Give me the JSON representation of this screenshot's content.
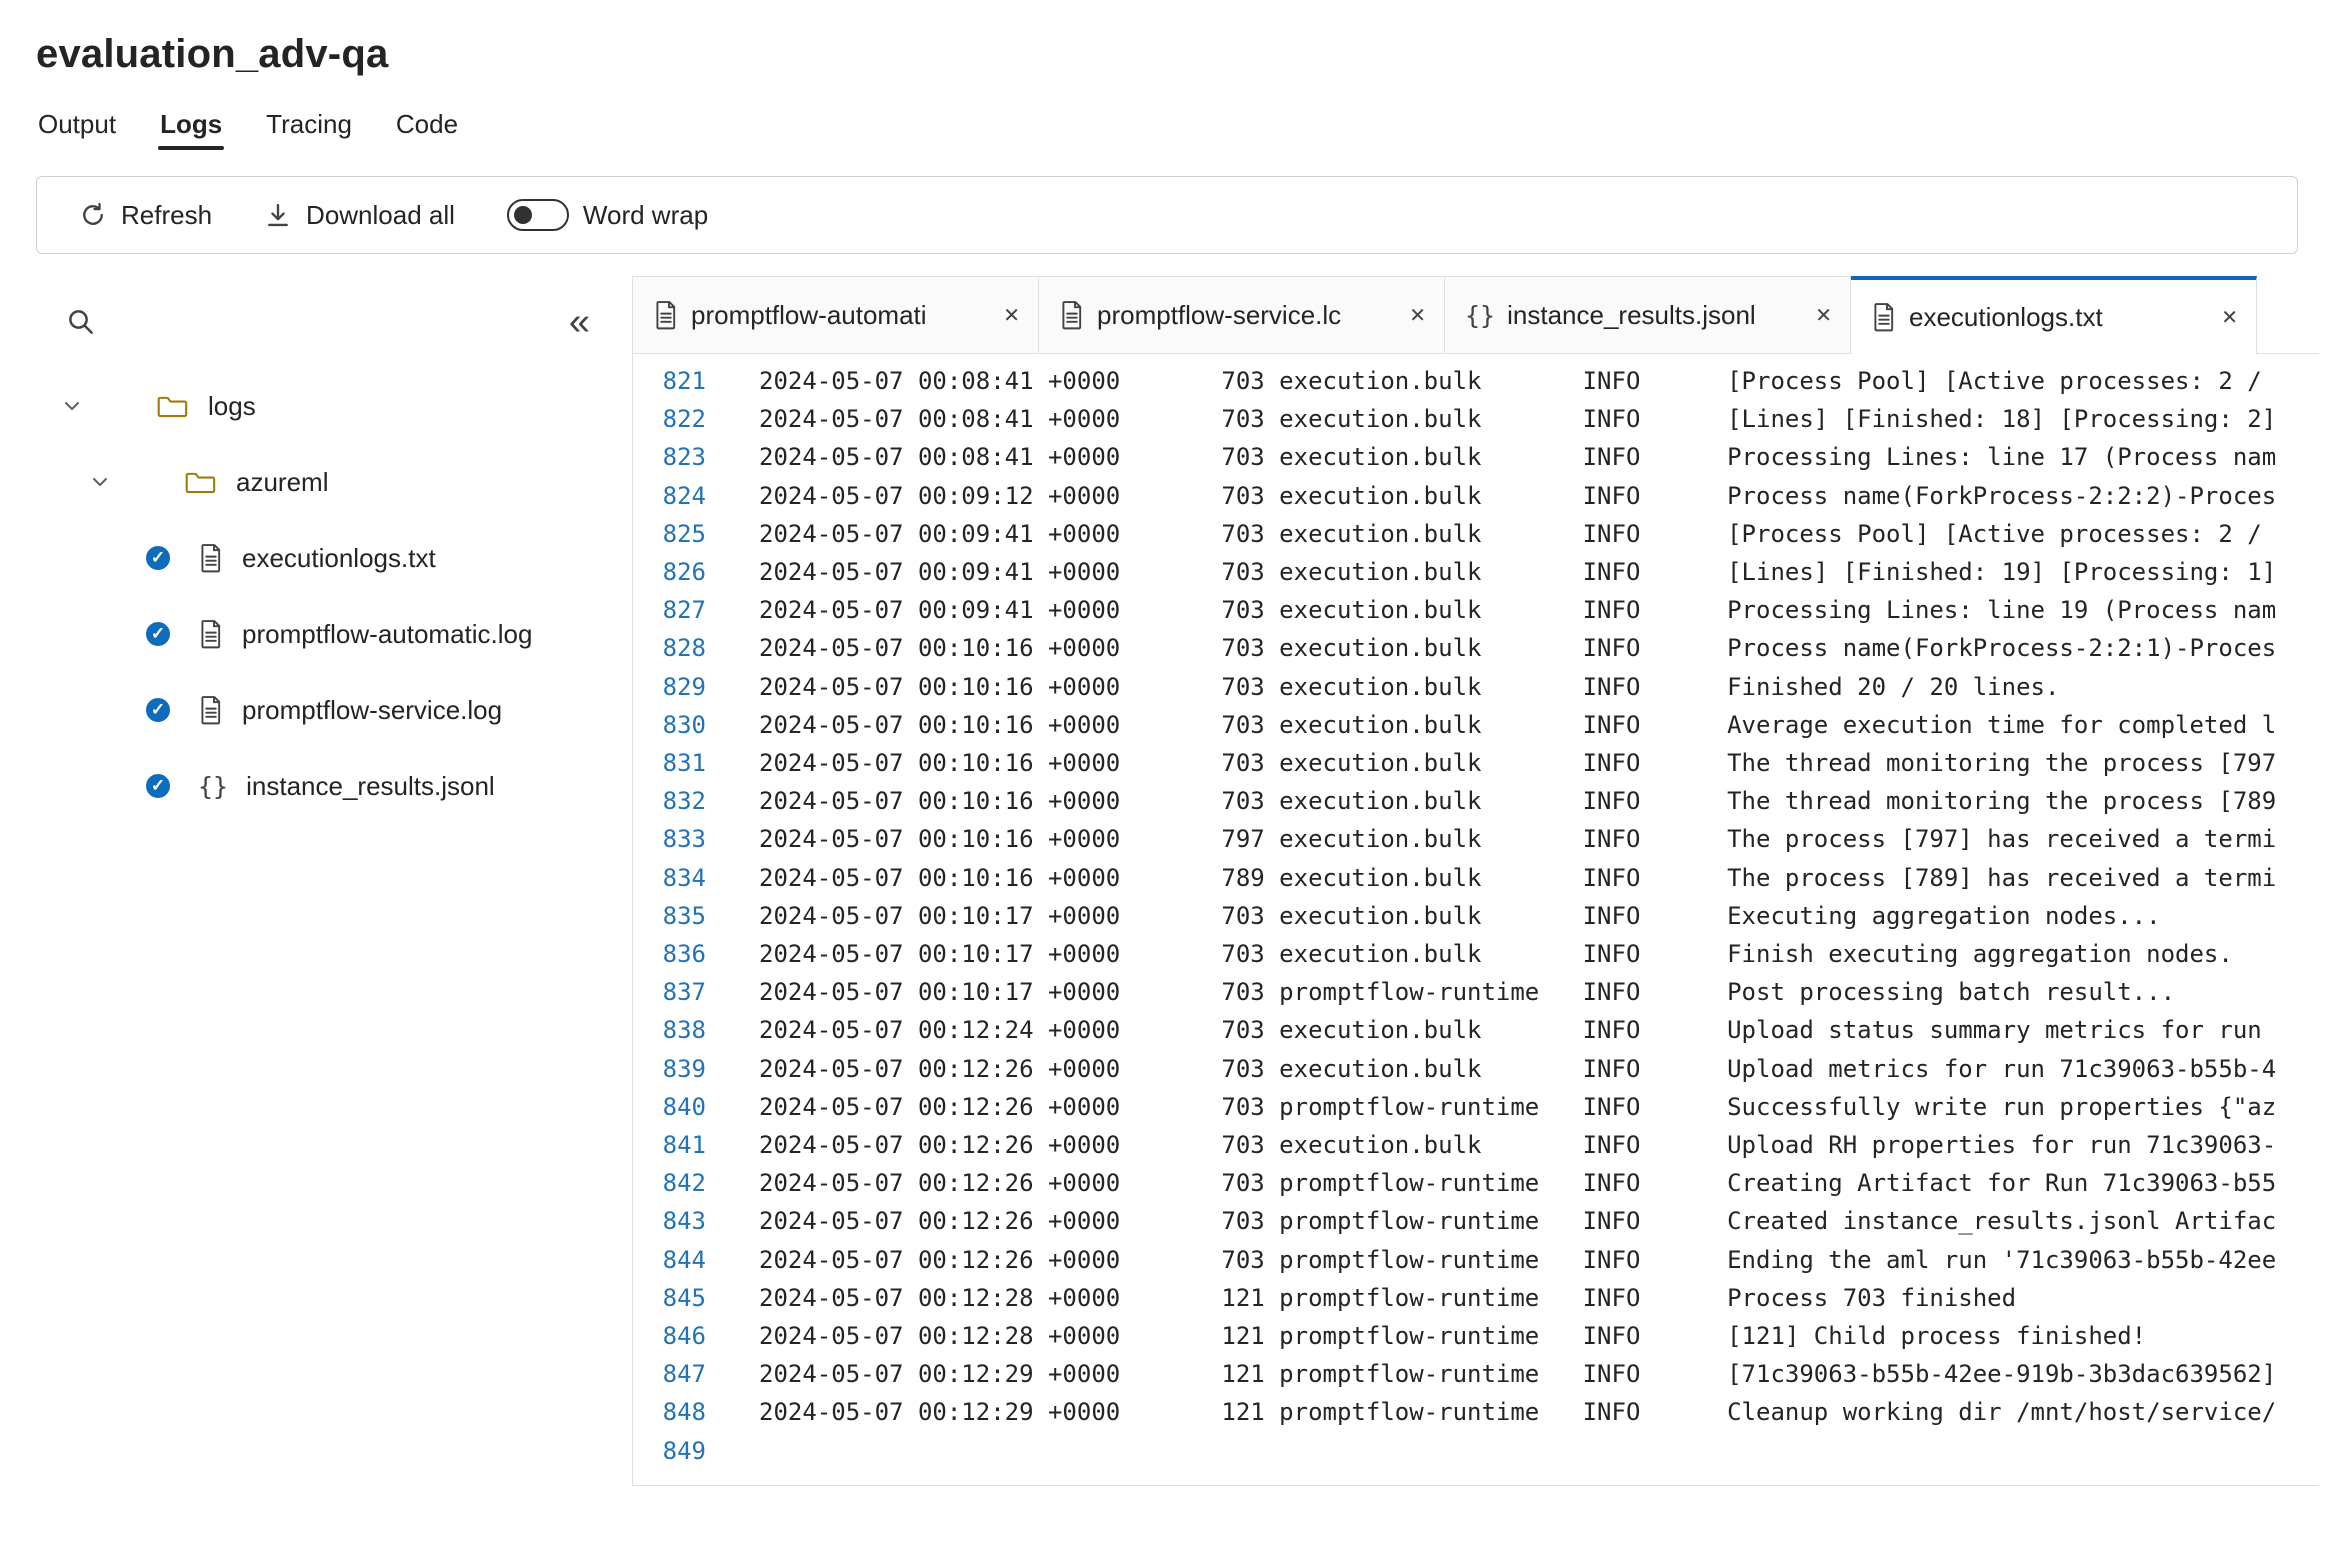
{
  "colors": {
    "accent_blue": "#1267b4",
    "check_badge": "#0f6cbd",
    "line_number": "#2272b9",
    "border": "#e0e0e0",
    "folder_icon": "#9d7d0a",
    "text": "#242424"
  },
  "icons": {
    "close": "✕",
    "collapse": "«",
    "check": "✓",
    "json_braces": "{}",
    "search": "svg-magnifier",
    "refresh": "svg-circular-arrow",
    "download": "svg-arrow-down-tray",
    "folder": "svg-folder",
    "doc": "svg-document",
    "chevron_down": "svg-chevron-down"
  },
  "header": {
    "title": "evaluation_adv-qa"
  },
  "nav_tabs": [
    {
      "label": "Output",
      "active": false
    },
    {
      "label": "Logs",
      "active": true
    },
    {
      "label": "Tracing",
      "active": false
    },
    {
      "label": "Code",
      "active": false
    }
  ],
  "toolbar": {
    "refresh": "Refresh",
    "download_all": "Download all",
    "word_wrap": "Word wrap",
    "word_wrap_enabled": false
  },
  "sidebar": {
    "tree": [
      {
        "kind": "folder",
        "label": "logs",
        "level": 0,
        "expanded": true
      },
      {
        "kind": "folder",
        "label": "azureml",
        "level": 1,
        "expanded": true
      },
      {
        "kind": "file",
        "icon": "doc",
        "label": "executionlogs.txt",
        "checked": true
      },
      {
        "kind": "file",
        "icon": "doc",
        "label": "promptflow-automatic.log",
        "checked": true
      },
      {
        "kind": "file",
        "icon": "doc",
        "label": "promptflow-service.log",
        "checked": true
      },
      {
        "kind": "file",
        "icon": "json",
        "label": "instance_results.jsonl",
        "checked": true
      }
    ]
  },
  "file_tabs": [
    {
      "icon": "doc",
      "label": "promptflow-automati",
      "active": false
    },
    {
      "icon": "doc",
      "label": "promptflow-service.lc",
      "active": false
    },
    {
      "icon": "json",
      "label": "instance_results.jsonl",
      "active": false
    },
    {
      "icon": "doc",
      "label": "executionlogs.txt",
      "active": true
    }
  ],
  "log": {
    "lines": [
      {
        "num": 821,
        "ts": "2024-05-07 00:08:41 +0000",
        "pid": "703",
        "module": "execution.bulk",
        "level": "INFO",
        "msg": "[Process Pool] [Active processes: 2 /"
      },
      {
        "num": 822,
        "ts": "2024-05-07 00:08:41 +0000",
        "pid": "703",
        "module": "execution.bulk",
        "level": "INFO",
        "msg": "[Lines] [Finished: 18] [Processing: 2]"
      },
      {
        "num": 823,
        "ts": "2024-05-07 00:08:41 +0000",
        "pid": "703",
        "module": "execution.bulk",
        "level": "INFO",
        "msg": "Processing Lines: line 17 (Process nam"
      },
      {
        "num": 824,
        "ts": "2024-05-07 00:09:12 +0000",
        "pid": "703",
        "module": "execution.bulk",
        "level": "INFO",
        "msg": "Process name(ForkProcess-2:2:2)-Proces"
      },
      {
        "num": 825,
        "ts": "2024-05-07 00:09:41 +0000",
        "pid": "703",
        "module": "execution.bulk",
        "level": "INFO",
        "msg": "[Process Pool] [Active processes: 2 /"
      },
      {
        "num": 826,
        "ts": "2024-05-07 00:09:41 +0000",
        "pid": "703",
        "module": "execution.bulk",
        "level": "INFO",
        "msg": "[Lines] [Finished: 19] [Processing: 1]"
      },
      {
        "num": 827,
        "ts": "2024-05-07 00:09:41 +0000",
        "pid": "703",
        "module": "execution.bulk",
        "level": "INFO",
        "msg": "Processing Lines: line 19 (Process nam"
      },
      {
        "num": 828,
        "ts": "2024-05-07 00:10:16 +0000",
        "pid": "703",
        "module": "execution.bulk",
        "level": "INFO",
        "msg": "Process name(ForkProcess-2:2:1)-Proces"
      },
      {
        "num": 829,
        "ts": "2024-05-07 00:10:16 +0000",
        "pid": "703",
        "module": "execution.bulk",
        "level": "INFO",
        "msg": "Finished 20 / 20 lines."
      },
      {
        "num": 830,
        "ts": "2024-05-07 00:10:16 +0000",
        "pid": "703",
        "module": "execution.bulk",
        "level": "INFO",
        "msg": "Average execution time for completed l"
      },
      {
        "num": 831,
        "ts": "2024-05-07 00:10:16 +0000",
        "pid": "703",
        "module": "execution.bulk",
        "level": "INFO",
        "msg": "The thread monitoring the process [797"
      },
      {
        "num": 832,
        "ts": "2024-05-07 00:10:16 +0000",
        "pid": "703",
        "module": "execution.bulk",
        "level": "INFO",
        "msg": "The thread monitoring the process [789"
      },
      {
        "num": 833,
        "ts": "2024-05-07 00:10:16 +0000",
        "pid": "797",
        "module": "execution.bulk",
        "level": "INFO",
        "msg": "The process [797] has received a termi"
      },
      {
        "num": 834,
        "ts": "2024-05-07 00:10:16 +0000",
        "pid": "789",
        "module": "execution.bulk",
        "level": "INFO",
        "msg": "The process [789] has received a termi"
      },
      {
        "num": 835,
        "ts": "2024-05-07 00:10:17 +0000",
        "pid": "703",
        "module": "execution.bulk",
        "level": "INFO",
        "msg": "Executing aggregation nodes..."
      },
      {
        "num": 836,
        "ts": "2024-05-07 00:10:17 +0000",
        "pid": "703",
        "module": "execution.bulk",
        "level": "INFO",
        "msg": "Finish executing aggregation nodes."
      },
      {
        "num": 837,
        "ts": "2024-05-07 00:10:17 +0000",
        "pid": "703",
        "module": "promptflow-runtime",
        "level": "INFO",
        "msg": "Post processing batch result..."
      },
      {
        "num": 838,
        "ts": "2024-05-07 00:12:24 +0000",
        "pid": "703",
        "module": "execution.bulk",
        "level": "INFO",
        "msg": "Upload status summary metrics for run"
      },
      {
        "num": 839,
        "ts": "2024-05-07 00:12:26 +0000",
        "pid": "703",
        "module": "execution.bulk",
        "level": "INFO",
        "msg": "Upload metrics for run 71c39063-b55b-4"
      },
      {
        "num": 840,
        "ts": "2024-05-07 00:12:26 +0000",
        "pid": "703",
        "module": "promptflow-runtime",
        "level": "INFO",
        "msg": "Successfully write run properties {\"az"
      },
      {
        "num": 841,
        "ts": "2024-05-07 00:12:26 +0000",
        "pid": "703",
        "module": "execution.bulk",
        "level": "INFO",
        "msg": "Upload RH properties for run 71c39063-"
      },
      {
        "num": 842,
        "ts": "2024-05-07 00:12:26 +0000",
        "pid": "703",
        "module": "promptflow-runtime",
        "level": "INFO",
        "msg": "Creating Artifact for Run 71c39063-b55"
      },
      {
        "num": 843,
        "ts": "2024-05-07 00:12:26 +0000",
        "pid": "703",
        "module": "promptflow-runtime",
        "level": "INFO",
        "msg": "Created instance_results.jsonl Artifac"
      },
      {
        "num": 844,
        "ts": "2024-05-07 00:12:26 +0000",
        "pid": "703",
        "module": "promptflow-runtime",
        "level": "INFO",
        "msg": "Ending the aml run '71c39063-b55b-42ee"
      },
      {
        "num": 845,
        "ts": "2024-05-07 00:12:28 +0000",
        "pid": "121",
        "module": "promptflow-runtime",
        "level": "INFO",
        "msg": "Process 703 finished"
      },
      {
        "num": 846,
        "ts": "2024-05-07 00:12:28 +0000",
        "pid": "121",
        "module": "promptflow-runtime",
        "level": "INFO",
        "msg": "[121] Child process finished!"
      },
      {
        "num": 847,
        "ts": "2024-05-07 00:12:29 +0000",
        "pid": "121",
        "module": "promptflow-runtime",
        "level": "INFO",
        "msg": "[71c39063-b55b-42ee-919b-3b3dac639562]"
      },
      {
        "num": 848,
        "ts": "2024-05-07 00:12:29 +0000",
        "pid": "121",
        "module": "promptflow-runtime",
        "level": "INFO",
        "msg": "Cleanup working dir /mnt/host/service/"
      },
      {
        "num": 849,
        "ts": "",
        "pid": "",
        "module": "",
        "level": "",
        "msg": ""
      }
    ]
  }
}
